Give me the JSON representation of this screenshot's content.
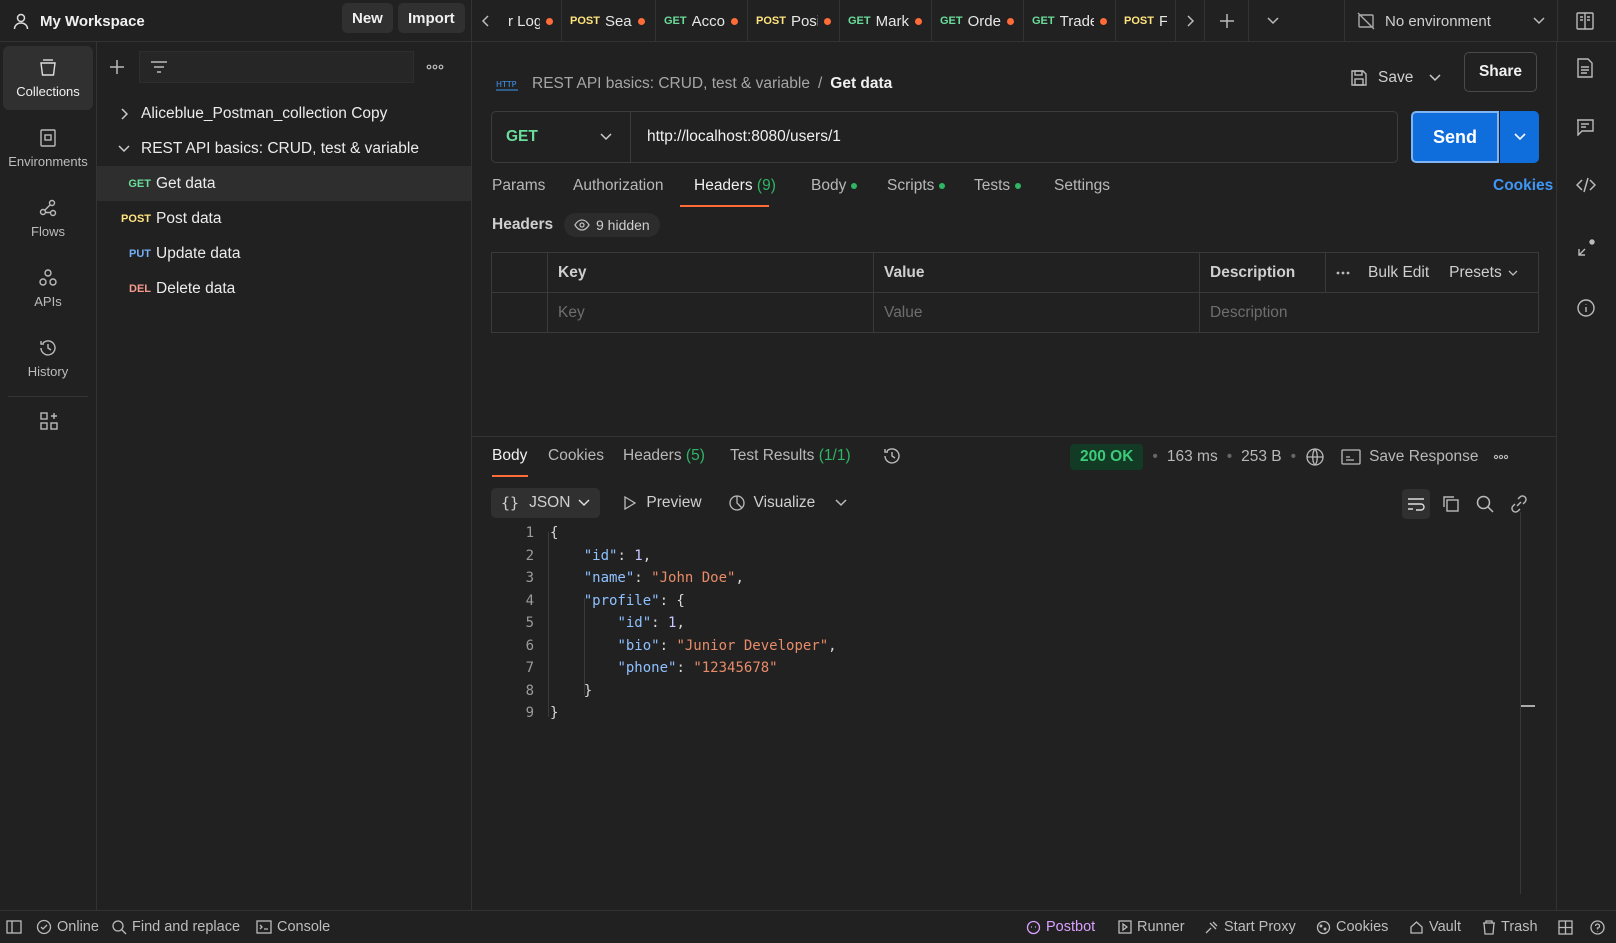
{
  "workspace": {
    "title": "My Workspace",
    "new_label": "New",
    "import_label": "Import"
  },
  "tabs": [
    {
      "method": "",
      "name": "r Log"
    },
    {
      "method": "POST",
      "name": "Sea"
    },
    {
      "method": "GET",
      "name": "Acco"
    },
    {
      "method": "POST",
      "name": "Posi"
    },
    {
      "method": "GET",
      "name": "Mark"
    },
    {
      "method": "GET",
      "name": "Orde"
    },
    {
      "method": "GET",
      "name": "Trade"
    },
    {
      "method": "POST",
      "name": "F"
    }
  ],
  "environment": {
    "selected": "No environment"
  },
  "rail": [
    {
      "label": "Collections",
      "icon": "collections-icon"
    },
    {
      "label": "Environments",
      "icon": "environments-icon"
    },
    {
      "label": "Flows",
      "icon": "flows-icon"
    },
    {
      "label": "APIs",
      "icon": "apis-icon"
    },
    {
      "label": "History",
      "icon": "history-icon"
    }
  ],
  "tree": {
    "collections": [
      {
        "name": "Aliceblue_Postman_collection Copy"
      },
      {
        "name": "REST API basics: CRUD, test & variable"
      }
    ],
    "requests": [
      {
        "method": "GET",
        "name": "Get data"
      },
      {
        "method": "POST",
        "name": "Post data"
      },
      {
        "method": "PUT",
        "name": "Update data"
      },
      {
        "method": "DEL",
        "name": "Delete data"
      }
    ]
  },
  "request": {
    "breadcrumb_parent": "REST API basics: CRUD, test & variable",
    "breadcrumb_sep": "/",
    "name": "Get data",
    "save_label": "Save",
    "share_label": "Share",
    "method": "GET",
    "url": "http://localhost:8080/users/1",
    "send_label": "Send",
    "tabs": {
      "params": "Params",
      "authorization": "Authorization",
      "headers": "Headers",
      "headers_count": "(9)",
      "body": "Body",
      "scripts": "Scripts",
      "tests": "Tests",
      "settings": "Settings",
      "cookies": "Cookies"
    },
    "headers_label": "Headers",
    "hidden_label": "9 hidden",
    "table": {
      "key": "Key",
      "value": "Value",
      "description": "Description",
      "bulk_edit": "Bulk Edit",
      "presets": "Presets",
      "key_placeholder": "Key",
      "value_placeholder": "Value",
      "description_placeholder": "Description"
    }
  },
  "response": {
    "tabs": {
      "body": "Body",
      "cookies": "Cookies",
      "headers": "Headers",
      "headers_count": "(5)",
      "tests": "Test Results",
      "tests_count": "(1/1)"
    },
    "status": "200 OK",
    "time": "163 ms",
    "size": "253 B",
    "save_response": "Save Response",
    "format": "JSON",
    "preview": "Preview",
    "visualize": "Visualize",
    "code_lines": [
      {
        "n": "1",
        "indent": "",
        "parts": [
          [
            "p",
            "{"
          ]
        ]
      },
      {
        "n": "2",
        "indent": "    ",
        "parts": [
          [
            "k",
            "\"id\""
          ],
          [
            "p",
            ": "
          ],
          [
            "n",
            "1"
          ],
          [
            "p",
            ","
          ]
        ]
      },
      {
        "n": "3",
        "indent": "    ",
        "parts": [
          [
            "k",
            "\"name\""
          ],
          [
            "p",
            ": "
          ],
          [
            "s",
            "\"John Doe\""
          ],
          [
            "p",
            ","
          ]
        ]
      },
      {
        "n": "4",
        "indent": "    ",
        "parts": [
          [
            "k",
            "\"profile\""
          ],
          [
            "p",
            ": {"
          ]
        ]
      },
      {
        "n": "5",
        "indent": "        ",
        "parts": [
          [
            "k",
            "\"id\""
          ],
          [
            "p",
            ": "
          ],
          [
            "n",
            "1"
          ],
          [
            "p",
            ","
          ]
        ]
      },
      {
        "n": "6",
        "indent": "        ",
        "parts": [
          [
            "k",
            "\"bio\""
          ],
          [
            "p",
            ": "
          ],
          [
            "s",
            "\"Junior Developer\""
          ],
          [
            "p",
            ","
          ]
        ]
      },
      {
        "n": "7",
        "indent": "        ",
        "parts": [
          [
            "k",
            "\"phone\""
          ],
          [
            "p",
            ": "
          ],
          [
            "s",
            "\"12345678\""
          ]
        ]
      },
      {
        "n": "8",
        "indent": "    ",
        "parts": [
          [
            "p",
            "}"
          ]
        ]
      },
      {
        "n": "9",
        "indent": "",
        "parts": [
          [
            "p",
            "}"
          ]
        ]
      }
    ]
  },
  "footer": {
    "online": "Online",
    "find_replace": "Find and replace",
    "console": "Console",
    "postbot": "Postbot",
    "runner": "Runner",
    "start_proxy": "Start Proxy",
    "cookies": "Cookies",
    "vault": "Vault",
    "trash": "Trash"
  },
  "colors": {
    "accent": "#ff6c37",
    "send": "#0f6edc",
    "status_ok": "#3ccb79",
    "link": "#3f96f5"
  }
}
